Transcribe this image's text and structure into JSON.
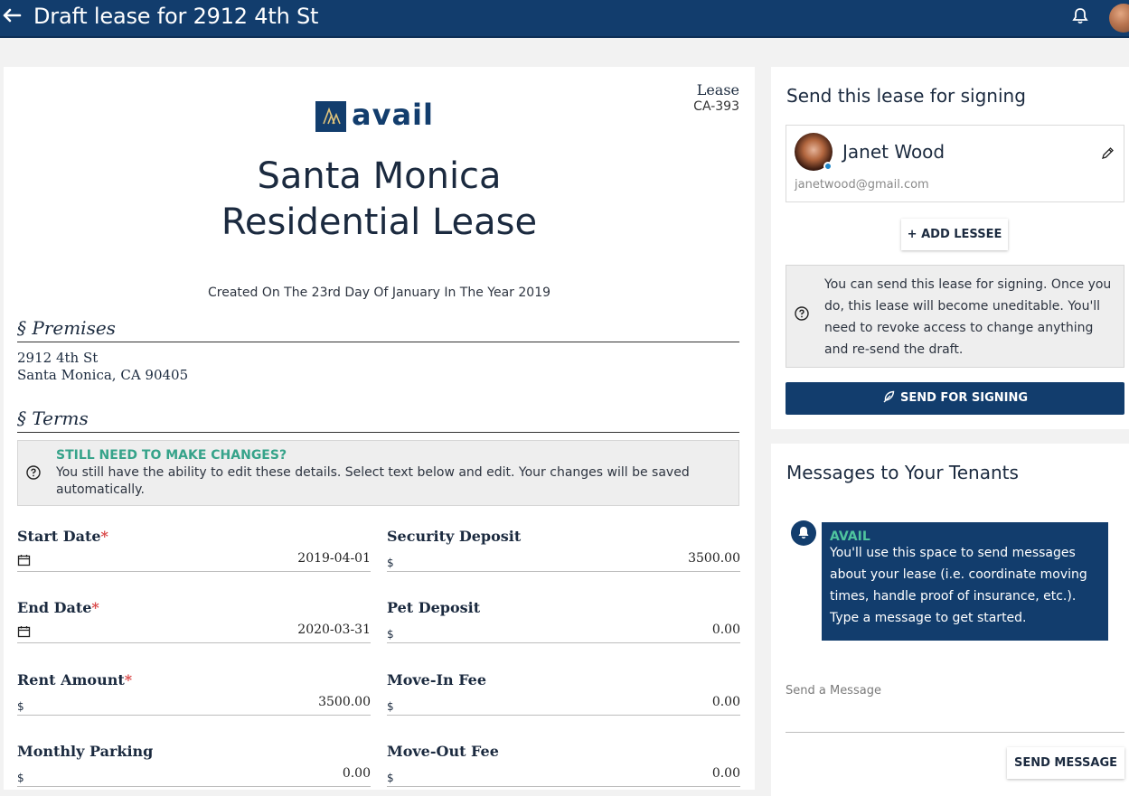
{
  "header": {
    "back_icon": "arrow-left-icon",
    "title": "Draft lease for 2912 4th St"
  },
  "document": {
    "lease_label": "Lease",
    "lease_id": "CA-393",
    "logo_text": "avail",
    "title_line1": "Santa Monica",
    "title_line2": "Residential Lease",
    "created": "Created On The 23rd Day Of January In The Year 2019",
    "premises_heading": "§  Premises",
    "address_line1": "2912 4th St",
    "address_line2": "Santa Monica, CA 90405",
    "terms_heading": "§  Terms",
    "notice_title": "STILL NEED TO MAKE CHANGES?",
    "notice_body": "You still have the ability to edit these details. Select text below and edit. Your changes will be saved automatically.",
    "fields": {
      "start_date": {
        "label": "Start Date",
        "value": "2019-04-01"
      },
      "end_date": {
        "label": "End Date",
        "value": "2020-03-31"
      },
      "rent": {
        "label": "Rent Amount",
        "prefix": "$",
        "value": "3500.00"
      },
      "parking": {
        "label": "Monthly Parking",
        "prefix": "$",
        "value": "0.00"
      },
      "security": {
        "label": "Security Deposit",
        "prefix": "$",
        "value": "3500.00"
      },
      "pet": {
        "label": "Pet Deposit",
        "prefix": "$",
        "value": "0.00"
      },
      "movein": {
        "label": "Move-In Fee",
        "prefix": "$",
        "value": "0.00"
      },
      "moveout": {
        "label": "Move-Out Fee",
        "prefix": "$",
        "value": "0.00"
      }
    },
    "required_mark": "*"
  },
  "signing": {
    "heading": "Send this lease for signing",
    "lessee_name": "Janet Wood",
    "lessee_email": "janetwood@gmail.com",
    "add_lessee": "+ ADD LESSEE",
    "info": "You can send this lease for signing. Once you do, this lease will become uneditable. You'll need to revoke access to change anything and re-send the draft.",
    "send_button": "SEND FOR SIGNING"
  },
  "messages": {
    "heading": "Messages to Your Tenants",
    "sender": "AVAIL",
    "body": "You'll use this space to send messages about your lease (i.e. coordinate moving times, handle proof of insurance, etc.). Type a message to get started.",
    "placeholder": "Send a Message",
    "send_button": "SEND MESSAGE"
  },
  "colors": {
    "primary": "#123d6d",
    "accent": "#36a38a",
    "required": "#d94848"
  }
}
